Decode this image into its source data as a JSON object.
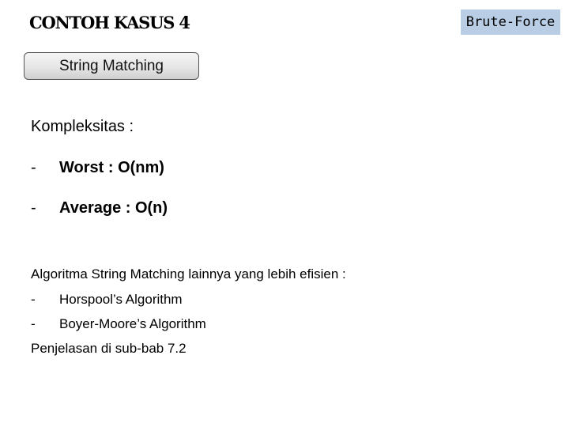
{
  "slide": {
    "title": "CONTOH KASUS 4",
    "badge": "Brute-Force",
    "section_button": "String Matching",
    "complexity": {
      "label": "Kompleksitas :",
      "items": [
        {
          "bullet": "-",
          "text": "Worst : O(nm)"
        },
        {
          "bullet": "-",
          "text": "Average : O(n)"
        }
      ]
    },
    "alternatives": {
      "label": "Algoritma String Matching lainnya yang lebih efisien :",
      "items": [
        {
          "bullet": "-",
          "text": "Horspool’s Algorithm"
        },
        {
          "bullet": "-",
          "text": "Boyer-Moore’s Algorithm"
        }
      ],
      "reference": "Penjelasan di sub-bab 7.2"
    }
  },
  "colors": {
    "badge_background": "#b9cde4",
    "button_border": "#555555",
    "text": "#000000"
  }
}
